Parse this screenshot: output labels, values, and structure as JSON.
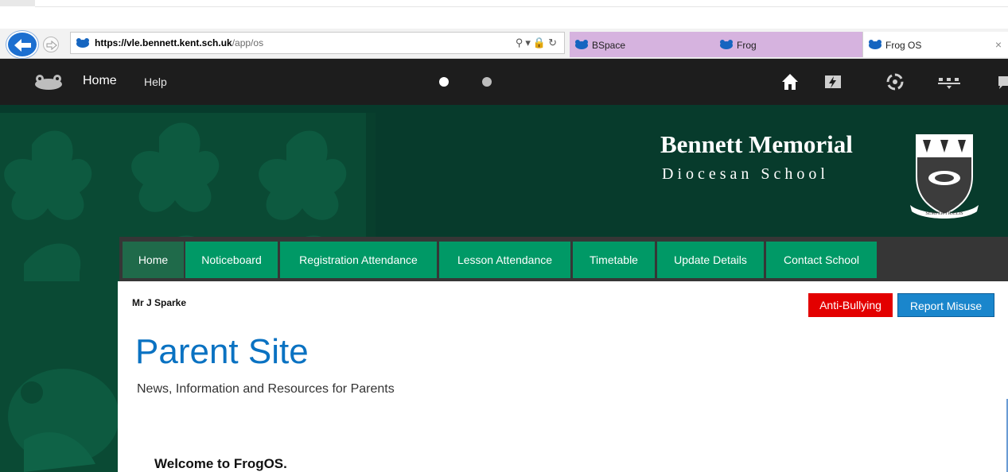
{
  "browser": {
    "url_host": "https://vle.bennett.kent.sch.uk",
    "url_path": "/app/os",
    "tabs": [
      {
        "label": "BSpace"
      },
      {
        "label": "Frog"
      },
      {
        "label": "Frog OS"
      }
    ],
    "tab_close": "×",
    "colors": {
      "back_button": "#1c6fd0",
      "inactive_tab": "#d6b3df"
    }
  },
  "frogbar": {
    "home_label": "Home",
    "help_label": "Help",
    "icons": [
      "frog-logo-icon",
      "home-icon",
      "lightning-icon",
      "spiral-icon",
      "sync-icon",
      "chat-icon"
    ]
  },
  "banner": {
    "school_name": "Bennett Memorial",
    "school_sub": "Diocesan School",
    "crest_motto": "SEMPER FIDELIS",
    "colors": {
      "dark_green": "#073b2c"
    }
  },
  "nav": {
    "items": [
      {
        "label": "Home",
        "active": true
      },
      {
        "label": "Noticeboard"
      },
      {
        "label": "Registration Attendance"
      },
      {
        "label": "Lesson Attendance"
      },
      {
        "label": "Timetable"
      },
      {
        "label": "Update Details"
      },
      {
        "label": "Contact School"
      }
    ],
    "colors": {
      "item": "#009966",
      "active": "#1f6a4a"
    }
  },
  "content": {
    "user_name": "Mr J Sparke",
    "anti_bullying_label": "Anti-Bullying",
    "report_misuse_label": "Report Misuse",
    "page_title": "Parent Site",
    "subtitle": "News, Information and Resources for Parents",
    "welcome": "Welcome to FrogOS.",
    "colors": {
      "anti_bullying": "#e30000",
      "report_misuse": "#1a86cc",
      "title": "#0a72c2"
    }
  }
}
